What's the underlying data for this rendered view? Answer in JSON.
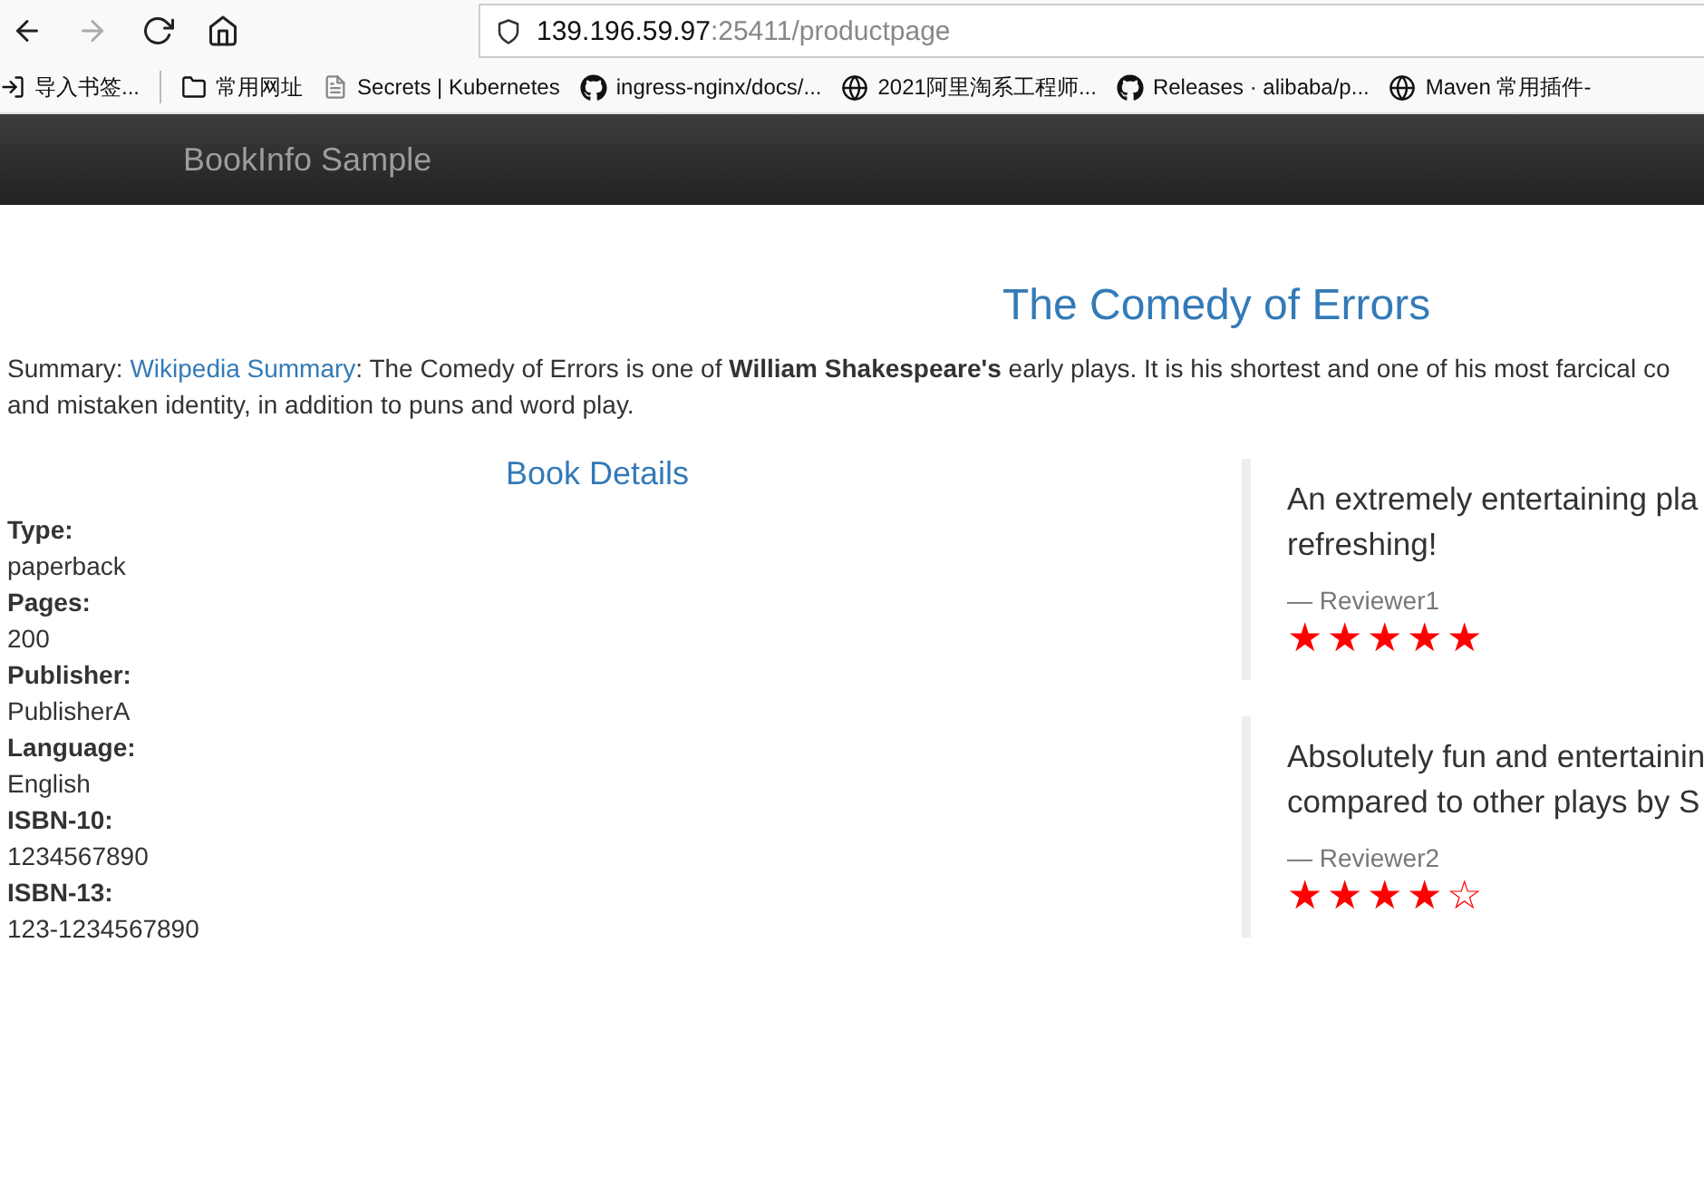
{
  "browser": {
    "url_host": "139.196.59.97",
    "url_path": ":25411/productpage",
    "bookmarks": [
      {
        "kind": "import",
        "label": "导入书签..."
      },
      {
        "kind": "folder",
        "label": "常用网址"
      },
      {
        "kind": "doc",
        "label": "Secrets | Kubernetes"
      },
      {
        "kind": "github",
        "label": "ingress-nginx/docs/..."
      },
      {
        "kind": "globe",
        "label": "2021阿里淘系工程师..."
      },
      {
        "kind": "github",
        "label": "Releases · alibaba/p..."
      },
      {
        "kind": "globe",
        "label": "Maven 常用插件-"
      }
    ]
  },
  "navbar": {
    "brand": "BookInfo Sample"
  },
  "book": {
    "title": "The Comedy of Errors",
    "summary_label": "Summary:",
    "summary_link": "Wikipedia Summary",
    "summary_text": ": The Comedy of Errors is one of **William Shakespeare's** early plays. It is his shortest and one of his most farcical co\nand mistaken identity, in addition to puns and word play."
  },
  "details": {
    "heading": "Book Details",
    "fields": [
      {
        "label": "Type:",
        "value": "paperback"
      },
      {
        "label": "Pages:",
        "value": "200"
      },
      {
        "label": "Publisher:",
        "value": "PublisherA"
      },
      {
        "label": "Language:",
        "value": "English"
      },
      {
        "label": "ISBN-10:",
        "value": "1234567890"
      },
      {
        "label": "ISBN-13:",
        "value": "123-1234567890"
      }
    ]
  },
  "reviews": [
    {
      "text": "An extremely entertaining pla\nrefreshing!",
      "reviewer": "— Reviewer1",
      "stars": 5
    },
    {
      "text": "Absolutely fun and entertainin\ncompared to other plays by S",
      "reviewer": "— Reviewer2",
      "stars": 4
    }
  ]
}
